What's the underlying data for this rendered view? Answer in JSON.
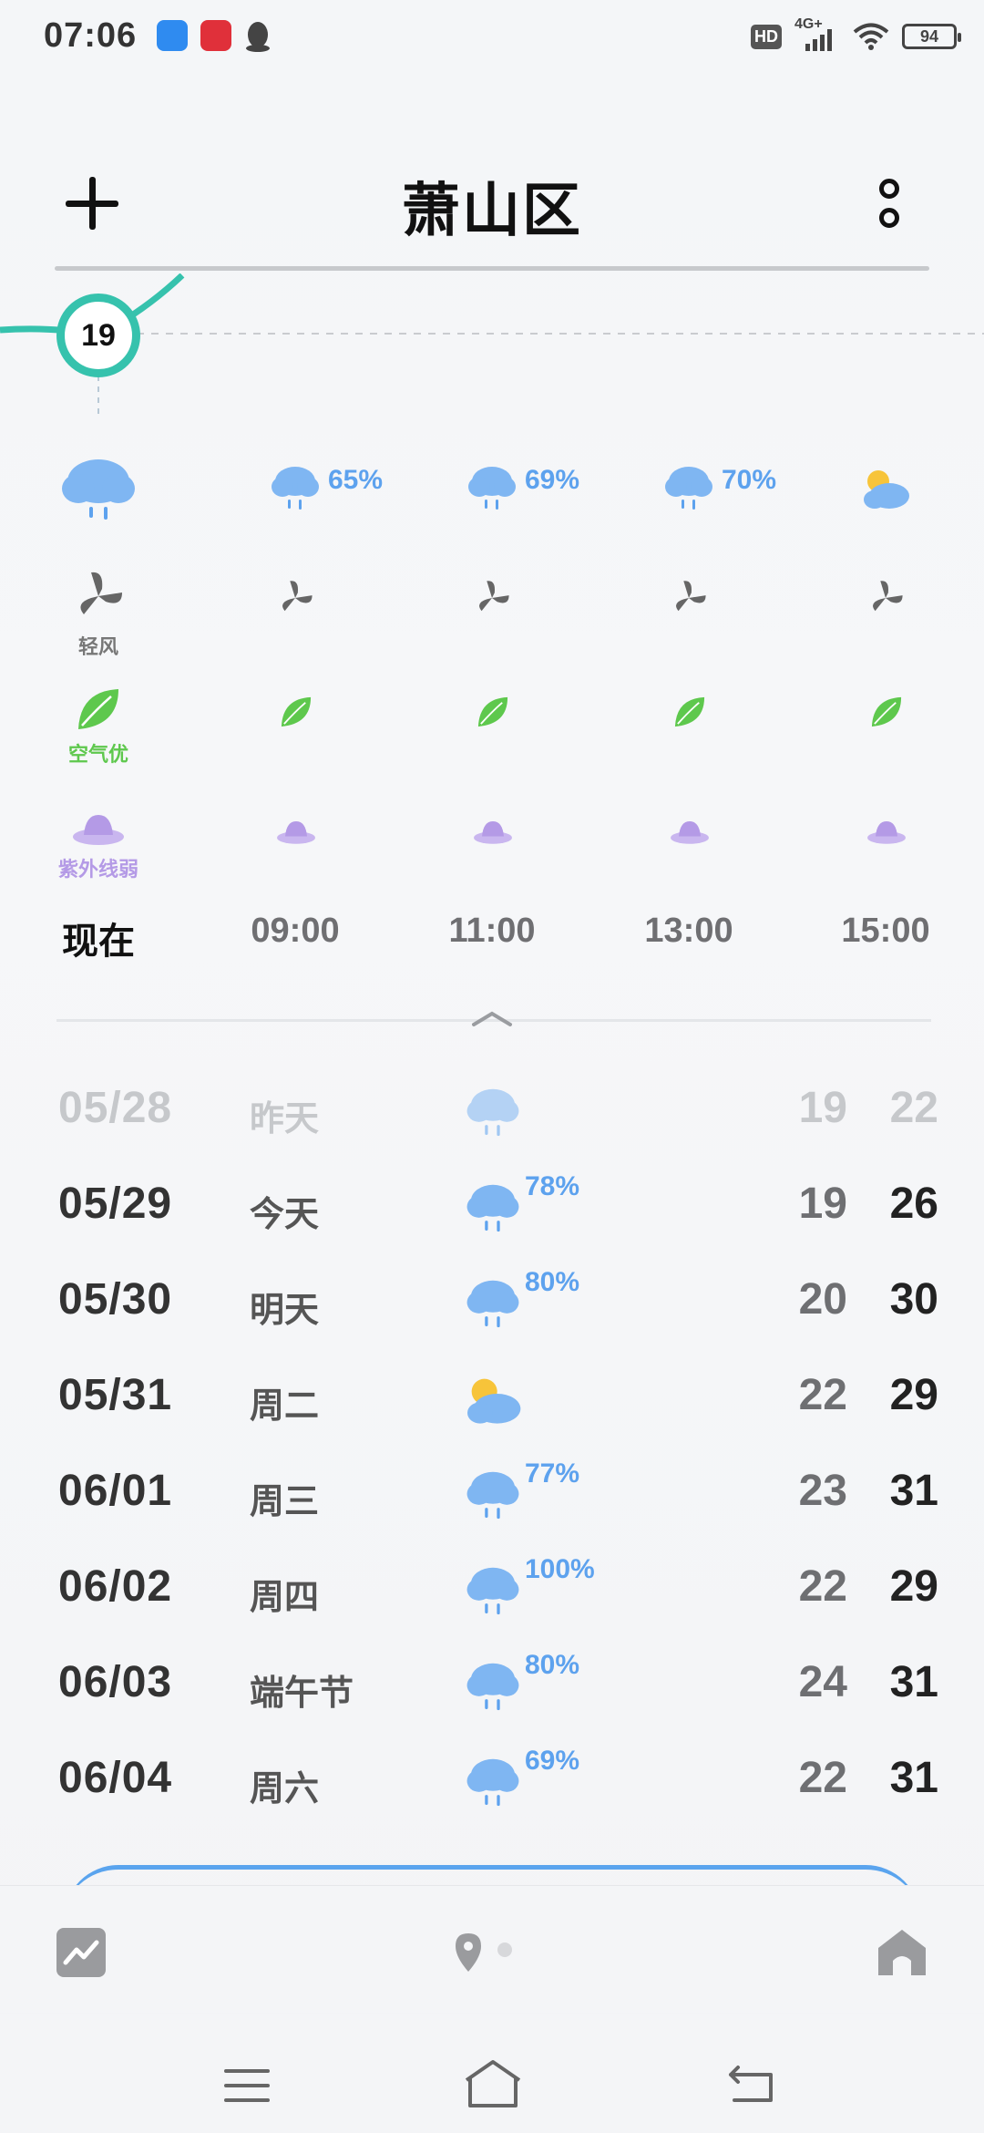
{
  "status_bar": {
    "time": "07:06",
    "hd": "HD",
    "network": "4G+",
    "battery": "94",
    "icons": [
      "app-blue-icon",
      "app-red-icon",
      "qq-penguin-icon",
      "signal-icon",
      "wifi-icon",
      "battery-icon"
    ]
  },
  "header": {
    "city": "萧山区",
    "add_icon": "plus-icon",
    "more_icon": "more-vertical-icon"
  },
  "hourly": {
    "current_temp": "19",
    "columns": [
      {
        "time": "现在",
        "precip": "",
        "weather": "rain",
        "wind_label": "轻风",
        "air_label": "空气优",
        "uv_label": "紫外线弱"
      },
      {
        "time": "09:00",
        "precip": "65%",
        "weather": "rain",
        "wind_label": "",
        "air_label": "",
        "uv_label": ""
      },
      {
        "time": "11:00",
        "precip": "69%",
        "weather": "rain",
        "wind_label": "",
        "air_label": "",
        "uv_label": ""
      },
      {
        "time": "13:00",
        "precip": "70%",
        "weather": "rain",
        "wind_label": "",
        "air_label": "",
        "uv_label": ""
      },
      {
        "time": "15:00",
        "precip": "",
        "weather": "partly-cloudy",
        "wind_label": "",
        "air_label": "",
        "uv_label": ""
      }
    ]
  },
  "daily": [
    {
      "date": "05/28",
      "day": "昨天",
      "weather": "rain",
      "precip": "",
      "low": "19",
      "high": "22",
      "past": true
    },
    {
      "date": "05/29",
      "day": "今天",
      "weather": "rain",
      "precip": "78%",
      "low": "19",
      "high": "26",
      "past": false
    },
    {
      "date": "05/30",
      "day": "明天",
      "weather": "rain",
      "precip": "80%",
      "low": "20",
      "high": "30",
      "past": false
    },
    {
      "date": "05/31",
      "day": "周二",
      "weather": "partly-cloudy",
      "precip": "",
      "low": "22",
      "high": "29",
      "past": false
    },
    {
      "date": "06/01",
      "day": "周三",
      "weather": "rain",
      "precip": "77%",
      "low": "23",
      "high": "31",
      "past": false
    },
    {
      "date": "06/02",
      "day": "周四",
      "weather": "rain",
      "precip": "100%",
      "low": "22",
      "high": "29",
      "past": false
    },
    {
      "date": "06/03",
      "day": "端午节",
      "weather": "rain",
      "precip": "80%",
      "low": "24",
      "high": "31",
      "past": false
    },
    {
      "date": "06/04",
      "day": "周六",
      "weather": "rain",
      "precip": "69%",
      "low": "22",
      "high": "31",
      "past": false
    }
  ],
  "colors": {
    "accent_teal": "#36c2ad",
    "rain_blue": "#5da2ee",
    "cloud_blue": "#7fb6f2",
    "leaf_green": "#5ec84d",
    "uv_purple": "#b49ae6",
    "sun_yellow": "#f7c43a"
  },
  "bottom_nav": {
    "icons": [
      "trend-chart-icon",
      "location-pin-icon",
      "home-icon"
    ]
  },
  "system_nav": {
    "icons": [
      "menu-icon",
      "home-outline-icon",
      "back-icon"
    ]
  }
}
